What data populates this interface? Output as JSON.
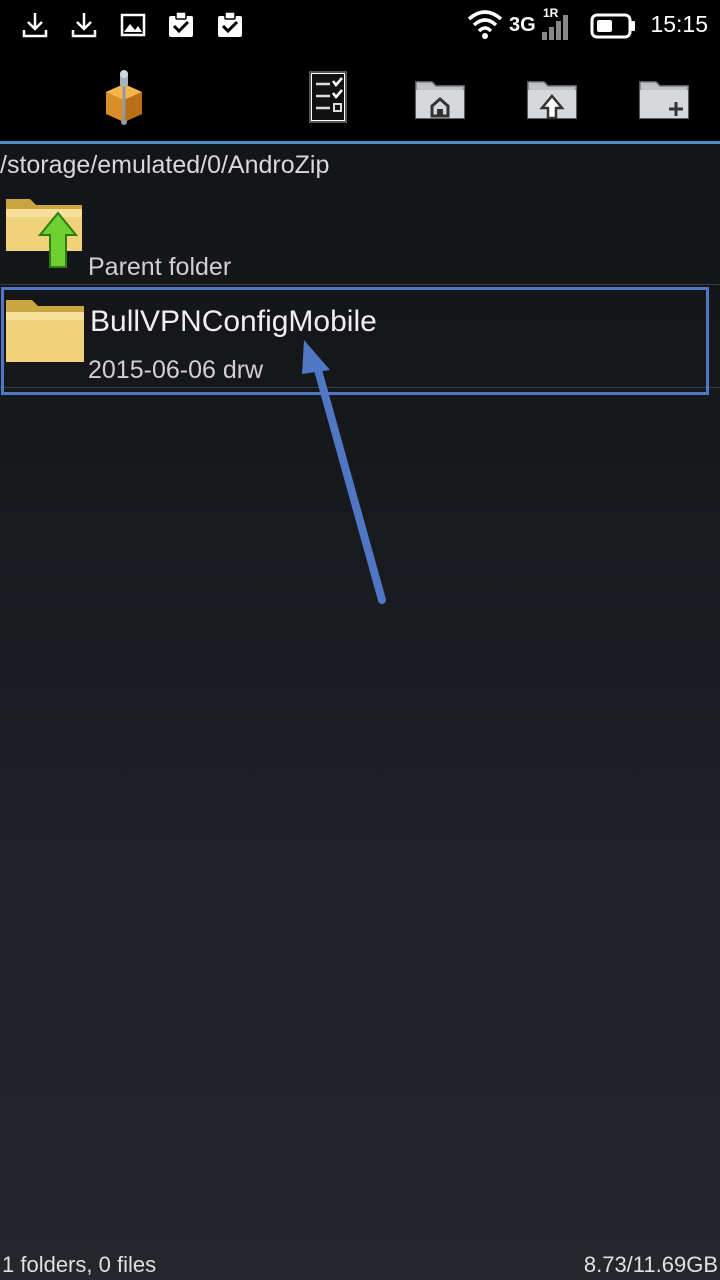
{
  "status_bar": {
    "time": "15:15",
    "network": "3G",
    "sim": "1R",
    "icons": [
      "download-icon",
      "download-icon",
      "image-icon",
      "clipboard-check-icon",
      "clipboard-check-icon",
      "wifi-icon",
      "signal-icon",
      "battery-icon"
    ]
  },
  "toolbar": {
    "buttons": [
      "app-logo-icon",
      "multiselect-icon",
      "home-folder-icon",
      "up-folder-icon",
      "new-folder-icon"
    ]
  },
  "path": "/storage/emulated/0/AndroZip",
  "list": {
    "parent": {
      "label": "Parent folder"
    },
    "items": [
      {
        "name": "BullVPNConfigMobile",
        "meta": "2015-06-06 drw"
      }
    ]
  },
  "footer": {
    "count": "1 folders, 0 files",
    "storage": "8.73/11.69GB"
  },
  "colors": {
    "accent": "#4a8ec4",
    "highlight": "#4f77c4",
    "folder": "#e8c96a"
  }
}
